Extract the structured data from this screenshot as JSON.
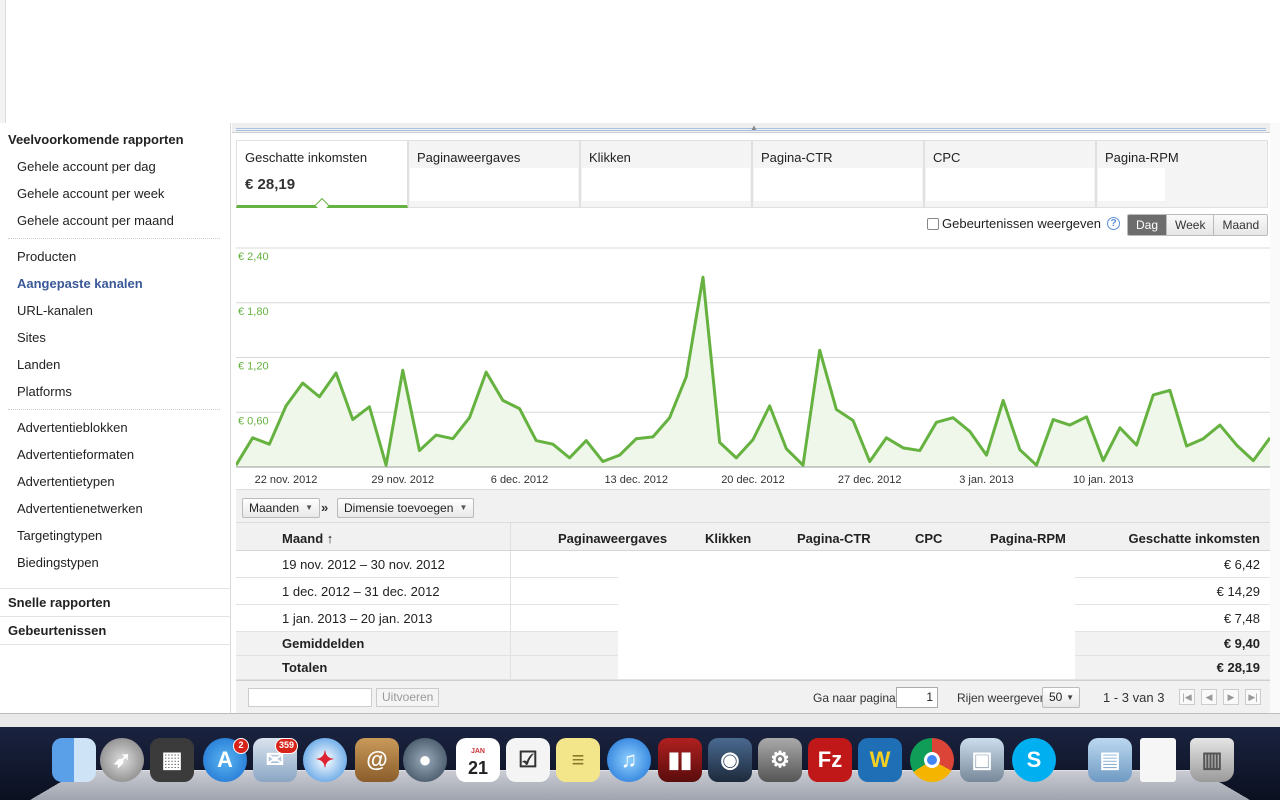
{
  "sidebar": {
    "section_common": "Veelvoorkomende rapporten",
    "account_items": [
      "Gehele account per dag",
      "Gehele account per week",
      "Gehele account per maand"
    ],
    "product_items": [
      "Producten",
      "Aangepaste kanalen",
      "URL-kanalen",
      "Sites",
      "Landen",
      "Platforms"
    ],
    "ad_items": [
      "Advertentieblokken",
      "Advertentieformaten",
      "Advertentietypen",
      "Advertentienetwerken",
      "Targetingtypen",
      "Biedingstypen"
    ],
    "section_quick": "Snelle rapporten",
    "section_events": "Gebeurtenissen"
  },
  "metric_tabs": [
    {
      "label": "Geschatte inkomsten",
      "value": "€ 28,19"
    },
    {
      "label": "Paginaweergaves"
    },
    {
      "label": "Klikken"
    },
    {
      "label": "Pagina-CTR"
    },
    {
      "label": "CPC"
    },
    {
      "label": "Pagina-RPM"
    }
  ],
  "chart_controls": {
    "events_label": "Gebeurtenissen weergeven",
    "help": "?",
    "periods": [
      "Dag",
      "Week",
      "Maand"
    ],
    "selected_period": "Dag"
  },
  "chart_data": {
    "type": "area",
    "title": "",
    "xlabel": "",
    "ylabel": "",
    "ylim": [
      0,
      2.4
    ],
    "y_ticks": [
      "€ 0,60",
      "€ 1,20",
      "€ 1,80",
      "€ 2,40"
    ],
    "x_ticks": [
      "22 nov. 2012",
      "29 nov. 2012",
      "6 dec. 2012",
      "13 dec. 2012",
      "20 dec. 2012",
      "27 dec. 2012",
      "3 jan. 2013",
      "10 jan. 2013"
    ],
    "x_start": "19 nov. 2012",
    "x_end": "20 jan. 2013",
    "values": [
      0.02,
      0.32,
      0.25,
      0.67,
      0.92,
      0.77,
      1.03,
      0.52,
      0.66,
      0.02,
      1.06,
      0.18,
      0.35,
      0.31,
      0.54,
      1.04,
      0.73,
      0.64,
      0.29,
      0.25,
      0.1,
      0.29,
      0.06,
      0.13,
      0.31,
      0.33,
      0.54,
      0.99,
      2.08,
      0.27,
      0.1,
      0.3,
      0.67,
      0.2,
      0.02,
      1.28,
      0.63,
      0.51,
      0.06,
      0.32,
      0.21,
      0.18,
      0.49,
      0.54,
      0.39,
      0.13,
      0.73,
      0.19,
      0.02,
      0.52,
      0.46,
      0.55,
      0.07,
      0.43,
      0.24,
      0.79,
      0.84,
      0.23,
      0.31,
      0.46,
      0.24,
      0.07,
      0.32
    ],
    "color": "#66b240",
    "fill": "#eef7e9"
  },
  "table_toolbar": {
    "dimension": "Maanden",
    "separator": "»",
    "add_dimension": "Dimensie toevoegen"
  },
  "table": {
    "columns": [
      "Maand",
      "Paginaweergaves",
      "Klikken",
      "Pagina-CTR",
      "CPC",
      "Pagina-RPM",
      "Geschatte inkomsten"
    ],
    "sort_indicator": "↑",
    "rows": [
      {
        "range": "19 nov. 2012 – 30 nov. 2012",
        "value": "€ 6,42"
      },
      {
        "range": "1 dec. 2012 – 31 dec. 2012",
        "value": "€ 14,29"
      },
      {
        "range": "1 jan. 2013 – 20 jan. 2013",
        "value": "€ 7,48"
      }
    ],
    "averages": {
      "label": "Gemiddelden",
      "value": "€ 9,40"
    },
    "totals": {
      "label": "Totalen",
      "value": "€ 28,19"
    }
  },
  "pager": {
    "filter_placeholder": "",
    "run_label": "Uitvoeren",
    "goto_label": "Ga naar pagina:",
    "goto_value": "1",
    "rows_label": "Rijen weergeven:",
    "rows_value": "50",
    "range_text": "1 - 3 van 3"
  },
  "dock": {
    "badges": [
      "2",
      "359"
    ],
    "calendar_month": "JAN",
    "calendar_day": "21"
  }
}
